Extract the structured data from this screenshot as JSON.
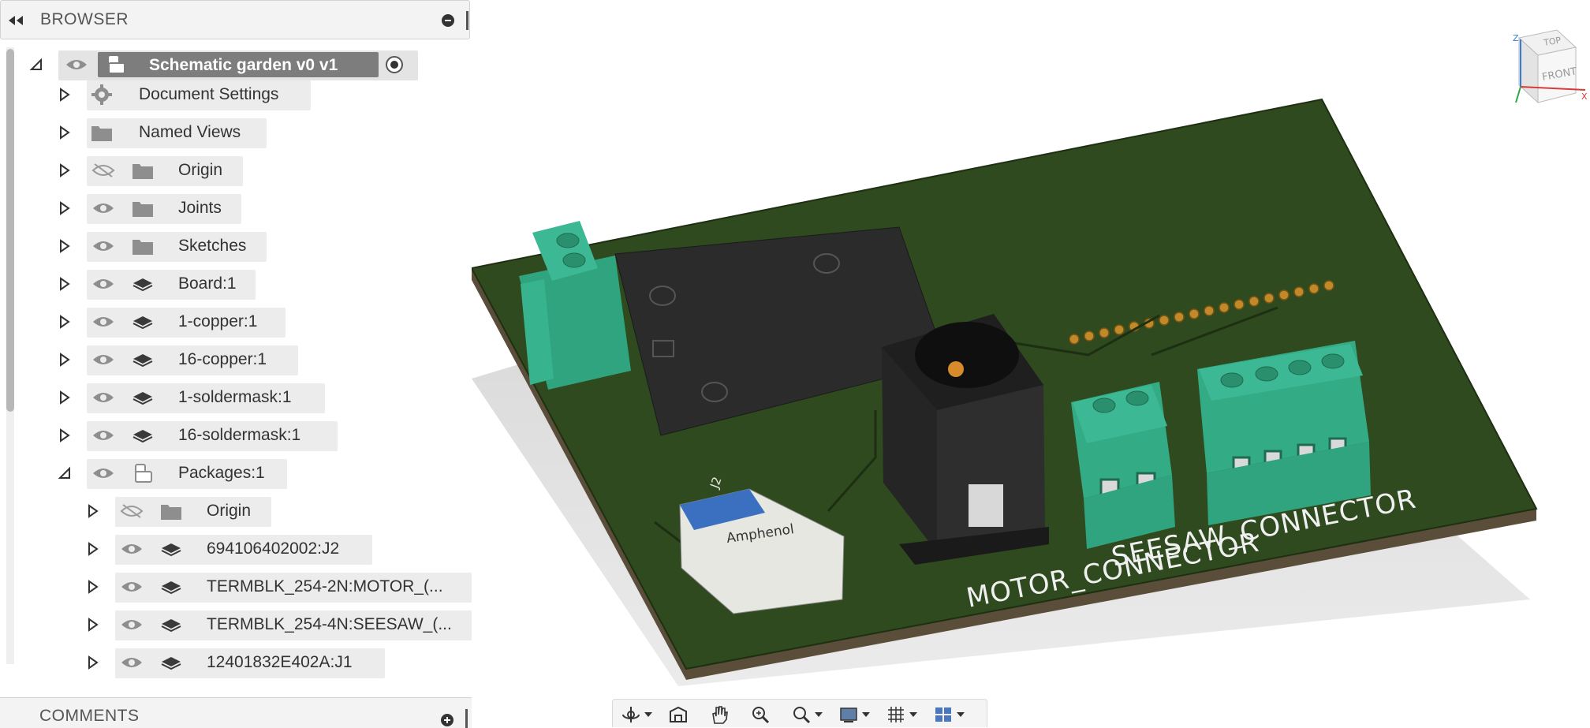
{
  "browser": {
    "title": "BROWSER",
    "root": {
      "label": "Schematic garden v0 v1"
    },
    "items": [
      {
        "label": "Document Settings",
        "icon": "gear-icon"
      },
      {
        "label": "Named Views",
        "icon": "folder-icon"
      },
      {
        "label": "Origin",
        "icon": "folder-icon",
        "visible": false
      },
      {
        "label": "Joints",
        "icon": "folder-icon",
        "visible": true
      },
      {
        "label": "Sketches",
        "icon": "folder-icon",
        "visible": true
      },
      {
        "label": "Board:1",
        "icon": "body-icon",
        "visible": true
      },
      {
        "label": "1-copper:1",
        "icon": "body-icon",
        "visible": true
      },
      {
        "label": "16-copper:1",
        "icon": "body-icon",
        "visible": true
      },
      {
        "label": "1-soldermask:1",
        "icon": "body-icon",
        "visible": true
      },
      {
        "label": "16-soldermask:1",
        "icon": "body-icon",
        "visible": true
      },
      {
        "label": "Packages:1",
        "icon": "component-icon",
        "visible": true,
        "expanded": true
      },
      {
        "label": "Origin",
        "icon": "folder-icon",
        "visible": false
      },
      {
        "label": "694106402002:J2",
        "icon": "body-icon",
        "visible": true
      },
      {
        "label": "TERMBLK_254-2N:MOTOR_(...",
        "icon": "body-icon",
        "visible": true
      },
      {
        "label": "TERMBLK_254-4N:SEESAW_(...",
        "icon": "body-icon",
        "visible": true
      },
      {
        "label": "12401832E402A:J1",
        "icon": "body-icon",
        "visible": true
      }
    ]
  },
  "comments": {
    "title": "COMMENTS"
  },
  "viewport": {
    "silkscreen": {
      "motor": "MOTOR_CONNECTOR",
      "seesaw": "SEESAW_CONNECTOR",
      "usb_brand": "Amphenol",
      "usb_ref": "J2"
    },
    "viewcube": {
      "top": "TOP",
      "front": "FRONT",
      "axis_z": "Z",
      "axis_x": "X"
    }
  },
  "colors": {
    "board": "#2f4a1f",
    "terminal": "#3cb894",
    "chip": "#2e2e2e",
    "row_chip": "#ececec",
    "selected": "#7d7d7d"
  }
}
